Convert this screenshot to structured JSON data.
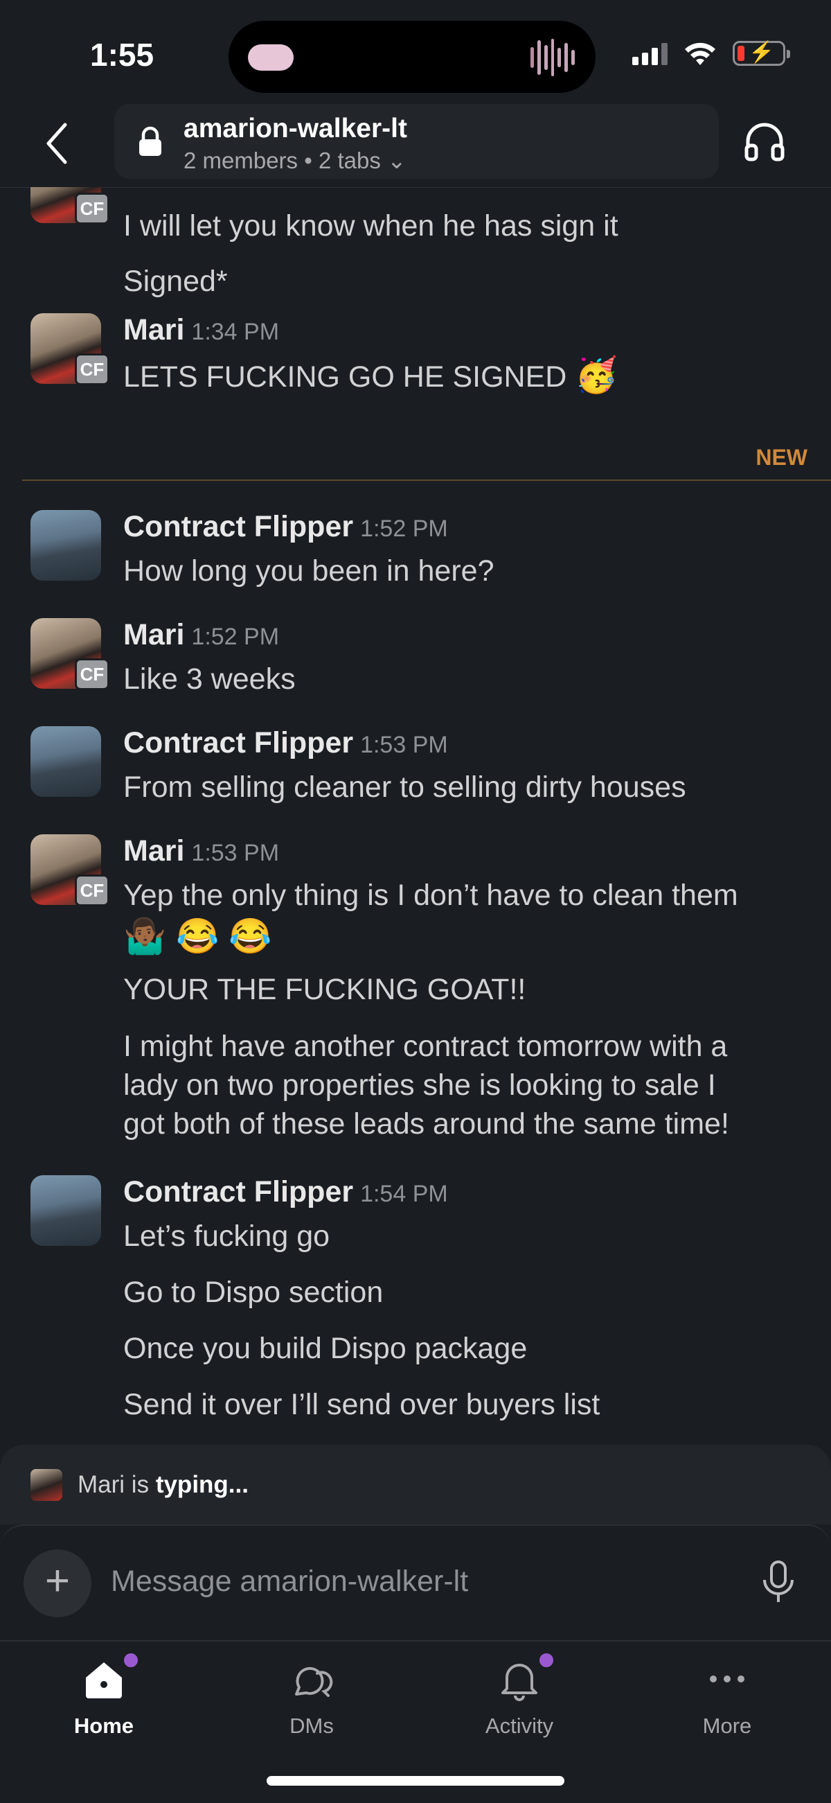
{
  "status_bar": {
    "time": "1:55"
  },
  "header": {
    "channel_name": "amarion-walker-lt",
    "subtitle": "2 members • 2 tabs ⌄"
  },
  "messages": {
    "group0": {
      "lines": [
        "I will let you know when he has sign it",
        "Signed*"
      ],
      "badge": "CF"
    },
    "group1": {
      "sender": "Mari",
      "time": "1:34 PM",
      "badge": "CF",
      "text": "LETS FUCKING GO HE SIGNED",
      "emoji": "🥳"
    },
    "new_label": "NEW",
    "group2": {
      "sender": "Contract Flipper",
      "time": "1:52 PM",
      "text": "How long you been in here?"
    },
    "group3": {
      "sender": "Mari",
      "time": "1:52 PM",
      "badge": "CF",
      "text": "Like 3 weeks"
    },
    "group4": {
      "sender": "Contract Flipper",
      "time": "1:53 PM",
      "text": "From selling cleaner to selling dirty houses"
    },
    "group5": {
      "sender": "Mari",
      "time": "1:53 PM",
      "badge": "CF",
      "line1": "Yep the only thing is I don’t have to clean them",
      "emojis": "🤷🏾‍♂️ 😂 😂",
      "line2": "YOUR THE FUCKING GOAT!!",
      "line3": "I might have another contract tomorrow with a",
      "line4": "lady on two properties she is looking to sale I",
      "line5": "got both of these leads around the same time!"
    },
    "group6": {
      "sender": "Contract Flipper",
      "time": "1:54 PM",
      "line1": "Let’s fucking go",
      "line2": "Go to Dispo section",
      "line3": "Once you build Dispo package",
      "line4": "Send it over I’ll send over buyers list"
    }
  },
  "typing": {
    "name": "Mari",
    "is": "is",
    "status": "typing..."
  },
  "composer": {
    "placeholder": "Message amarion-walker-lt"
  },
  "tabs": [
    {
      "label": "Home",
      "icon": "home-icon"
    },
    {
      "label": "DMs",
      "icon": "dms-icon"
    },
    {
      "label": "Activity",
      "icon": "bell-icon"
    },
    {
      "label": "More",
      "icon": "more-icon"
    }
  ],
  "colors": {
    "background": "#1a1d21",
    "accent_new": "#d1893a",
    "notification_dot": "#9b59d0"
  }
}
